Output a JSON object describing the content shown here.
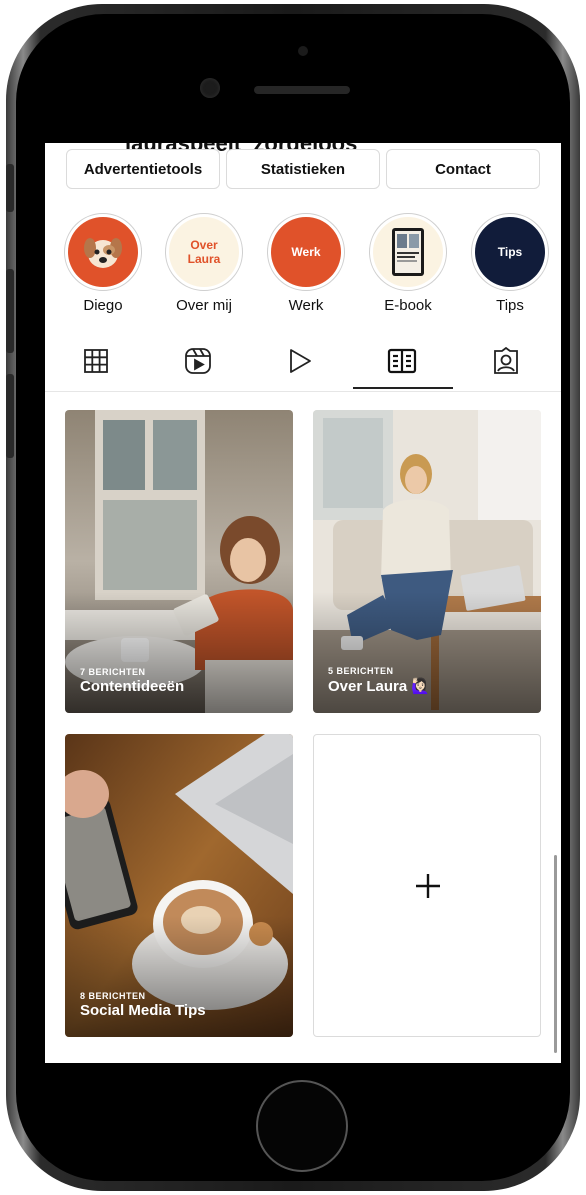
{
  "profile": {
    "title_cutoff": "lauraspeelt_zorgeloos"
  },
  "buttons": [
    "Advertentietools",
    "Statistieken",
    "Contact"
  ],
  "highlights": [
    {
      "label": "Diego",
      "cover_text": "",
      "icon": "dog-face-icon",
      "bg": "#e0522a"
    },
    {
      "label": "Over mij",
      "cover_text": "Over Laura",
      "cover_line1": "Over",
      "cover_line2": "Laura",
      "bg": "#fbf3e2",
      "fg": "#e0522a"
    },
    {
      "label": "Werk",
      "cover_text": "Werk",
      "bg": "#e0522a",
      "fg": "#ffffff"
    },
    {
      "label": "E-book",
      "cover_text": "",
      "icon": "ebook-cover-icon",
      "bg": "#fbf3e2"
    },
    {
      "label": "Tips",
      "cover_text": "Tips",
      "bg": "#111c3a",
      "fg": "#ffffff"
    }
  ],
  "tabs": [
    {
      "name": "grid-icon",
      "active": false
    },
    {
      "name": "reels-icon",
      "active": false
    },
    {
      "name": "video-icon",
      "active": false
    },
    {
      "name": "guides-icon",
      "active": true
    },
    {
      "name": "tagged-icon",
      "active": false
    }
  ],
  "guides": [
    {
      "count": "7 BERICHTEN",
      "title": "Contentideeën"
    },
    {
      "count": "5 BERICHTEN",
      "title": "Over Laura 🙋🏻‍♀️"
    },
    {
      "count": "8 BERICHTEN",
      "title": "Social Media Tips"
    }
  ],
  "add_guide": {
    "icon": "plus-icon",
    "symbol": "+"
  },
  "colors": {
    "accent": "#e0522a",
    "navy": "#111c3a",
    "cream": "#fbf3e2"
  }
}
